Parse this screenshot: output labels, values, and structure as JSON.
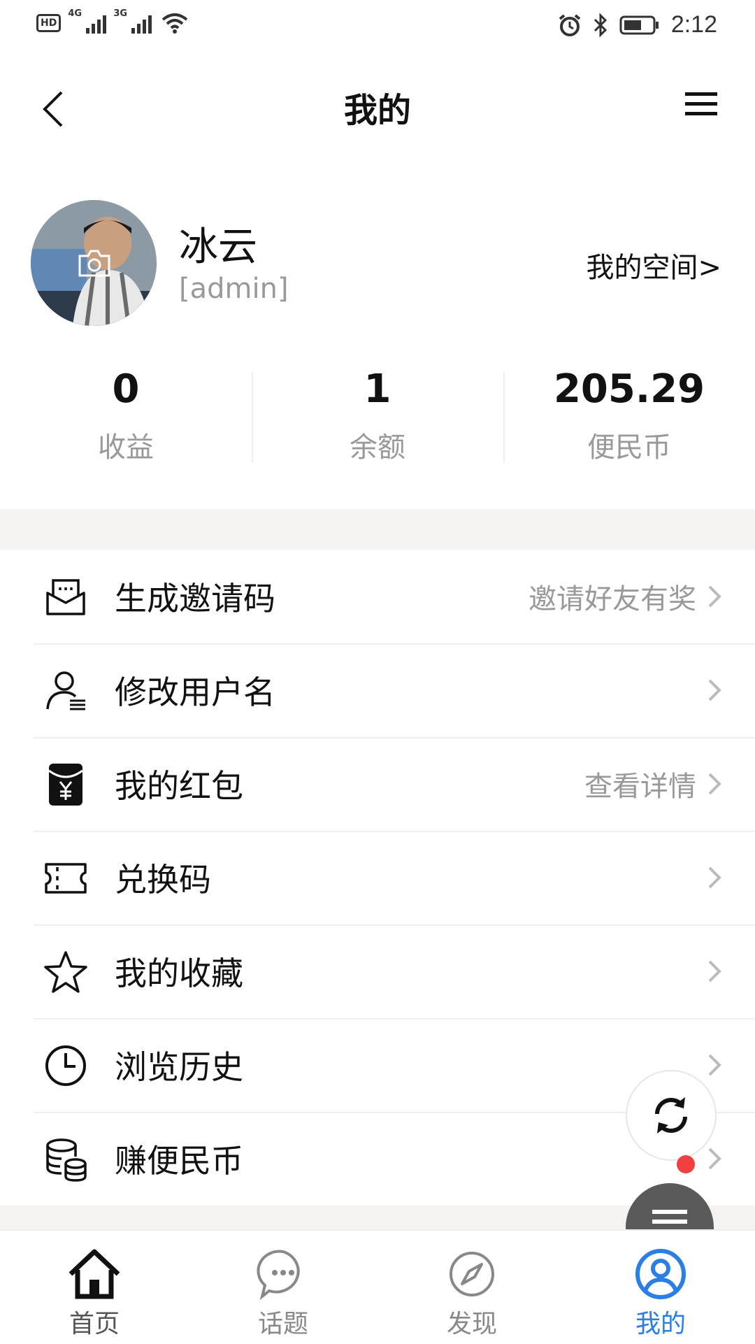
{
  "status_bar": {
    "network_1": "4G",
    "network_2": "3G",
    "time": "2:12"
  },
  "nav": {
    "title": "我的"
  },
  "profile": {
    "name": "冰云",
    "role": "[admin]",
    "space_link": "我的空间>"
  },
  "stats": [
    {
      "value": "0",
      "label": "收益"
    },
    {
      "value": "1",
      "label": "余额"
    },
    {
      "value": "205.29",
      "label": "便民币"
    }
  ],
  "menu": [
    {
      "icon": "invite-icon",
      "label": "生成邀请码",
      "hint": "邀请好友有奖"
    },
    {
      "icon": "user-edit-icon",
      "label": "修改用户名",
      "hint": ""
    },
    {
      "icon": "red-packet-icon",
      "label": "我的红包",
      "hint": "查看详情"
    },
    {
      "icon": "ticket-icon",
      "label": "兑换码",
      "hint": ""
    },
    {
      "icon": "star-icon",
      "label": "我的收藏",
      "hint": ""
    },
    {
      "icon": "clock-icon",
      "label": "浏览历史",
      "hint": ""
    },
    {
      "icon": "coins-icon",
      "label": "赚便民币",
      "hint": ""
    }
  ],
  "tabs": [
    {
      "icon": "home-icon",
      "label": "首页"
    },
    {
      "icon": "chat-icon",
      "label": "话题"
    },
    {
      "icon": "compass-icon",
      "label": "发现"
    },
    {
      "icon": "user-circle-icon",
      "label": "我的"
    }
  ],
  "colors": {
    "accent": "#2a7ee6",
    "notice_dot": "#f04040",
    "section_bg": "#f5f2f0"
  }
}
